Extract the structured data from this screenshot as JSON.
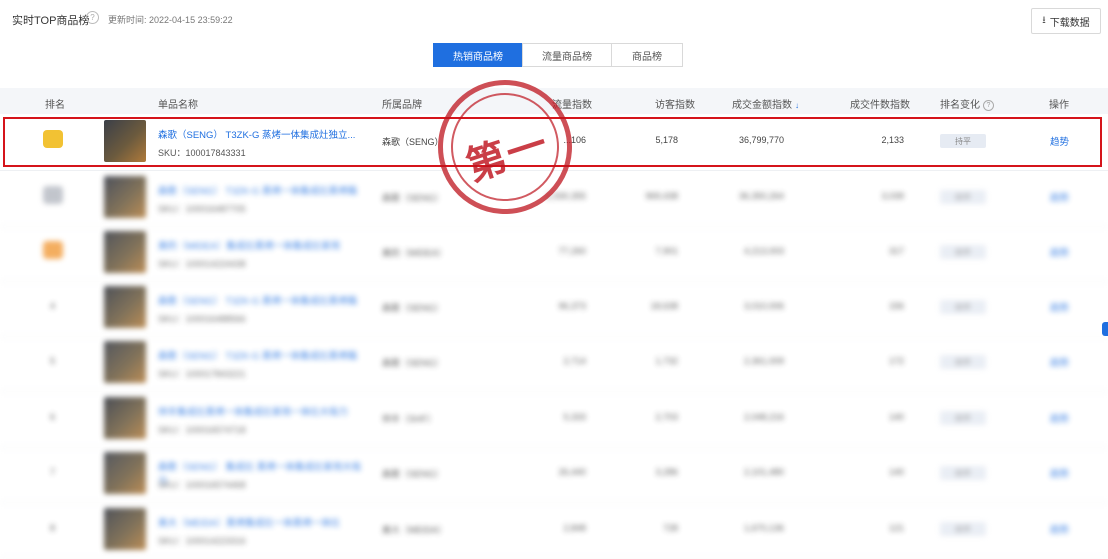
{
  "header": {
    "title": "实时TOP商品榜",
    "update_label": "更新时间:",
    "update_time": "2022-04-15 23:59:22",
    "download_label": "下载数据"
  },
  "tabs": [
    {
      "label": "热销商品榜",
      "active": true
    },
    {
      "label": "流量商品榜",
      "active": false
    },
    {
      "label": "商品榜",
      "active": false
    }
  ],
  "columns": {
    "rank": "排名",
    "product": "单品名称",
    "brand": "所属品牌",
    "traffic": "流量指数",
    "visitors": "访客指数",
    "amount": "成交金额指数",
    "orders": "成交件数指数",
    "rank_change": "排名变化",
    "action": "操作"
  },
  "stamp_text": "第一",
  "rows": [
    {
      "rank": "",
      "name": "森歌（SENG） T3ZK-G 蒸烤一体集成灶独立...",
      "sku": "SKU：100017843331",
      "brand": "森歌（SENG）",
      "traffic": "...106",
      "visitors": "5,178",
      "amount": "36,799,770",
      "orders": "2,133",
      "trend": "持平",
      "action": "趋势",
      "badge_color": "#f2c233"
    },
    {
      "rank": "",
      "name": "森歌（SENG） T3ZK-G 蒸烤一体集成灶蒸烤箱",
      "sku": "SKU：100016487705",
      "brand": "森歌（SENG）",
      "traffic": "1,930,355",
      "visitors": "969,438",
      "amount": "36,350,264",
      "orders": "3,039",
      "trend": "持平",
      "action": "趋势",
      "badge_color": "#b8bcc4"
    },
    {
      "rank": "",
      "name": "美的（MIDEA）集成灶蒸烤一体集成灶家用",
      "sku": "SKU：100014224438",
      "brand": "美的（MIDEA）",
      "traffic": "77,260",
      "visitors": "7,901",
      "amount": "4,213,003",
      "orders": "317",
      "trend": "持平",
      "action": "趋势",
      "badge_color": "#f2a045"
    },
    {
      "rank": "4",
      "name": "森歌（SENG） T3ZK-G 蒸烤一体集成灶蒸烤箱",
      "sku": "SKU：100016488566",
      "brand": "森歌（SENG）",
      "traffic": "96,373",
      "visitors": "18,638",
      "amount": "3,010,006",
      "orders": "156",
      "trend": "持平",
      "action": "趋势",
      "badge_color": ""
    },
    {
      "rank": "5",
      "name": "森歌（SENG） T3ZK-G 蒸烤一体集成灶蒸烤箱",
      "sku": "SKU：100017843221",
      "brand": "森歌（SENG）",
      "traffic": "2,714",
      "visitors": "1,732",
      "amount": "2,361,009",
      "orders": "172",
      "trend": "持平",
      "action": "趋势",
      "badge_color": ""
    },
    {
      "rank": "6",
      "name": "帅丰集成灶蒸烤一体集成灶家用一体灶大吸力",
      "sku": "SKU：100016574718",
      "brand": "帅丰（SHF）",
      "traffic": "5,333",
      "visitors": "2,703",
      "amount": "2,048,216",
      "orders": "140",
      "trend": "持平",
      "action": "趋势",
      "badge_color": ""
    },
    {
      "rank": "7",
      "name": "森歌（SENG） 集成灶 蒸烤一体集成灶家用大吸力",
      "sku": "SKU：100016574468",
      "brand": "森歌（SENG）",
      "traffic": "26,440",
      "visitors": "3,286",
      "amount": "2,101,480",
      "orders": "140",
      "trend": "持平",
      "action": "趋势",
      "badge_color": ""
    },
    {
      "rank": "8",
      "name": "美大（MEIDA）蒸烤集成灶一体蒸烤一体灶",
      "sku": "SKU：100014223316",
      "brand": "美大（MEIDA）",
      "traffic": "2,848",
      "visitors": "728",
      "amount": "1,670,136",
      "orders": "121",
      "trend": "持平",
      "action": "趋势",
      "badge_color": ""
    }
  ]
}
